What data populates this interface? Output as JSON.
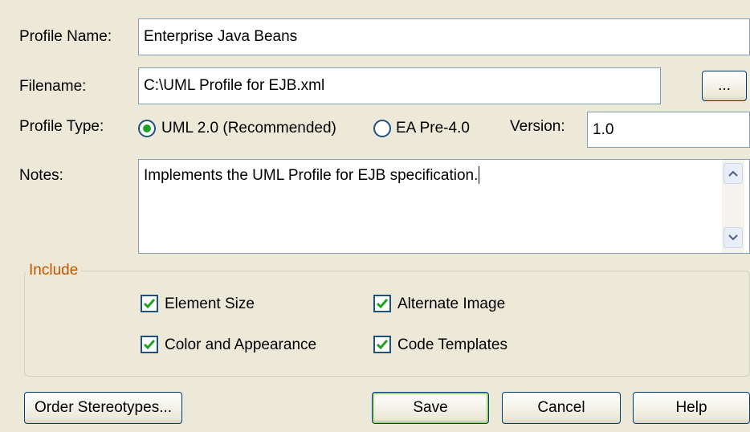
{
  "labels": {
    "profile_name": "Profile Name:",
    "filename": "Filename:",
    "profile_type": "Profile Type:",
    "version": "Version:",
    "notes": "Notes:"
  },
  "fields": {
    "profile_name": "Enterprise Java Beans",
    "filename": "C:\\UML Profile for EJB.xml",
    "version": "1.0",
    "notes": "Implements the UML Profile for EJB specification."
  },
  "browse_button": "...",
  "profile_type_options": [
    {
      "label": "UML 2.0 (Recommended)",
      "selected": true
    },
    {
      "label": "EA Pre-4.0",
      "selected": false
    }
  ],
  "include": {
    "title": "Include",
    "items": [
      {
        "label": "Element Size",
        "checked": true
      },
      {
        "label": "Alternate Image",
        "checked": true
      },
      {
        "label": "Color and Appearance",
        "checked": true
      },
      {
        "label": "Code Templates",
        "checked": true
      }
    ]
  },
  "buttons": {
    "order_stereotypes": "Order Stereotypes...",
    "save": "Save",
    "cancel": "Cancel",
    "help": "Help"
  },
  "colors": {
    "dialog_bg": "#ece9d8",
    "legend_text": "#c45500",
    "check_mark": "#21a121"
  }
}
